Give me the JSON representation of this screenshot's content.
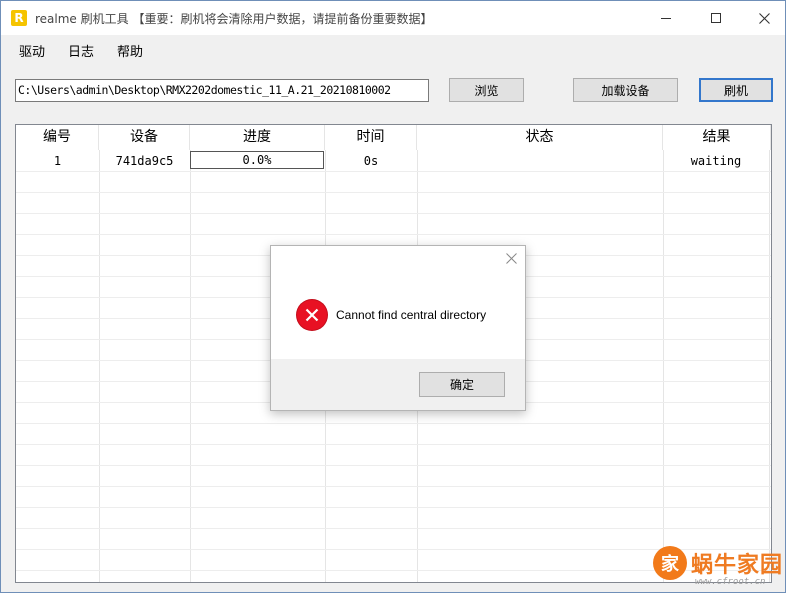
{
  "window": {
    "title": "realme 刷机工具 【重要：刷机将会清除用户数据，请提前备份重要数据】",
    "icon_letter": "R",
    "icons": {
      "app": "realme-logo-icon",
      "minimize": "minimize-icon",
      "maximize": "maximize-icon",
      "close": "close-icon"
    }
  },
  "menu": {
    "items": [
      {
        "label": "驱动"
      },
      {
        "label": "日志"
      },
      {
        "label": "帮助"
      }
    ]
  },
  "toolbar": {
    "path_value": "C:\\Users\\admin\\Desktop\\RMX2202domestic_11_A.21_20210810002",
    "browse_label": "浏览",
    "load_device_label": "加载设备",
    "flash_label": "刷机"
  },
  "table": {
    "columns": [
      "编号",
      "设备",
      "进度",
      "时间",
      "状态",
      "结果"
    ],
    "rows": [
      {
        "id": "1",
        "device": "741da9c5",
        "progress": "0.0%",
        "time": "0s",
        "status": "",
        "result": "waiting"
      }
    ]
  },
  "dialog": {
    "message": "Cannot find central directory",
    "ok_label": "确定",
    "icon": "error-icon",
    "error_color": "#e81123"
  },
  "watermark": {
    "text": "蜗牛家园",
    "url": "www.cfroot.cn",
    "logo_char": "家"
  }
}
